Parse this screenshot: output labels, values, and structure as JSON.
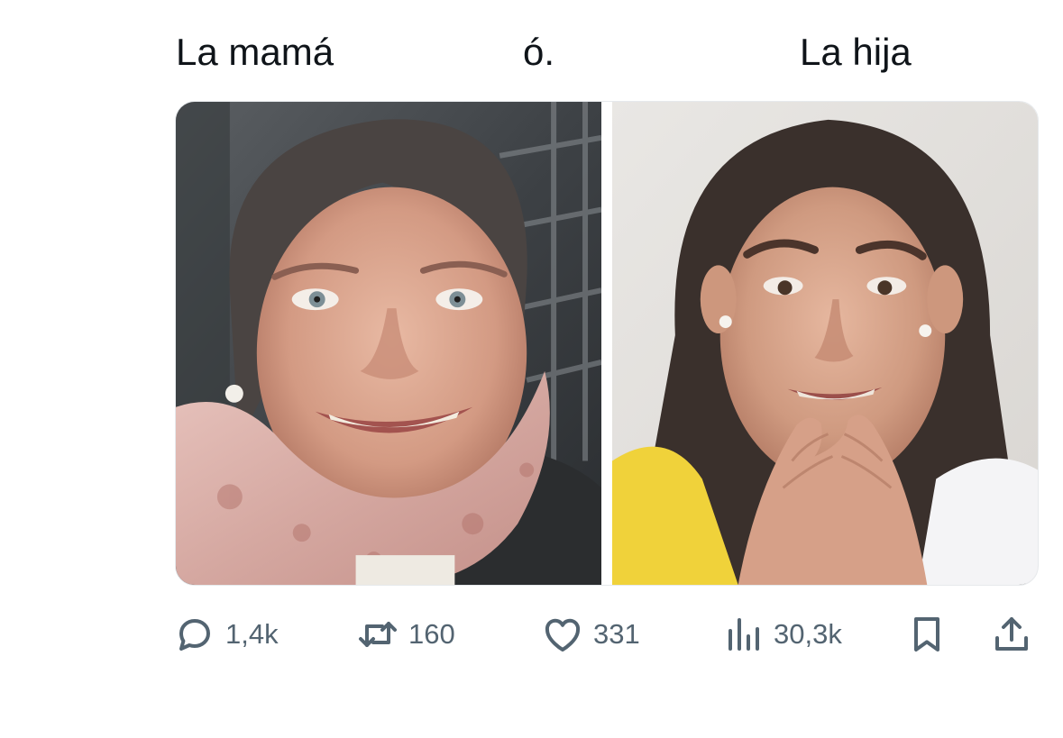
{
  "captions": {
    "left": "La mamá",
    "middle": "ó.",
    "right": "La hija"
  },
  "media": {
    "left_alt": "",
    "right_alt": ""
  },
  "actions": {
    "reply": {
      "icon": "reply-icon",
      "count": "1,4k"
    },
    "retweet": {
      "icon": "retweet-icon",
      "count": "160"
    },
    "like": {
      "icon": "heart-icon",
      "count": "331"
    },
    "views": {
      "icon": "views-icon",
      "count": "30,3k"
    },
    "bookmark": {
      "icon": "bookmark-icon"
    },
    "share": {
      "icon": "share-icon"
    }
  },
  "colors": {
    "text": "#0f1419",
    "icon": "#536471",
    "background": "#ffffff"
  }
}
